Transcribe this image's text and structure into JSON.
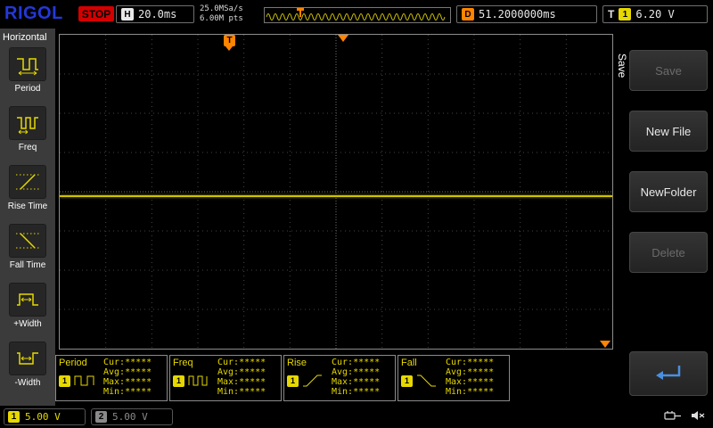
{
  "colors": {
    "accent_yellow": "#e6d800",
    "accent_orange": "#ff8400",
    "logo_blue": "#2438d8",
    "stop_red": "#d40000",
    "channel2_gray": "#8a8a8a"
  },
  "topbar": {
    "logo": "RIGOL",
    "run_state": "STOP",
    "horizontal_label": "H",
    "timebase": "20.0ms",
    "sample_rate": "25.0MSa/s",
    "memory_depth": "6.00M pts",
    "delay_label": "D",
    "delay_value": "51.2000000ms",
    "trigger_label": "T",
    "trigger_channel": "1",
    "trigger_level": "6.20 V"
  },
  "left_menu": {
    "title": "Horizontal",
    "items": [
      {
        "label": "Period",
        "icon": "period-icon"
      },
      {
        "label": "Freq",
        "icon": "freq-icon"
      },
      {
        "label": "Rise Time",
        "icon": "rise-time-icon"
      },
      {
        "label": "Fall Time",
        "icon": "fall-time-icon"
      },
      {
        "label": "+Width",
        "icon": "plus-width-icon"
      },
      {
        "label": "-Width",
        "icon": "minus-width-icon"
      }
    ]
  },
  "display": {
    "trigger_flag": "T"
  },
  "right_menu": {
    "tab_title": "Save",
    "buttons": [
      {
        "label": "Save",
        "enabled": false
      },
      {
        "label": "New File",
        "enabled": true
      },
      {
        "label": "NewFolder",
        "enabled": true
      },
      {
        "label": "Delete",
        "enabled": false
      },
      {
        "label": "",
        "icon": "return-arrow-icon",
        "enabled": true
      }
    ]
  },
  "measurements": [
    {
      "name": "Period",
      "channel": "1",
      "icon": "period-icon",
      "cur": "Cur:*****",
      "avg": "Avg:*****",
      "max": "Max:*****",
      "min": "Min:*****"
    },
    {
      "name": "Freq",
      "channel": "1",
      "icon": "freq-icon",
      "cur": "Cur:*****",
      "avg": "Avg:*****",
      "max": "Max:*****",
      "min": "Min:*****"
    },
    {
      "name": "Rise",
      "channel": "1",
      "icon": "rise-icon",
      "cur": "Cur:*****",
      "avg": "Avg:*****",
      "max": "Max:*****",
      "min": "Min:*****"
    },
    {
      "name": "Fall",
      "channel": "1",
      "icon": "fall-icon",
      "cur": "Cur:*****",
      "avg": "Avg:*****",
      "max": "Max:*****",
      "min": "Min:*****"
    }
  ],
  "status_bar": {
    "channels": [
      {
        "number": "1",
        "scale": "5.00 V"
      },
      {
        "number": "2",
        "scale": "5.00 V"
      }
    ]
  }
}
